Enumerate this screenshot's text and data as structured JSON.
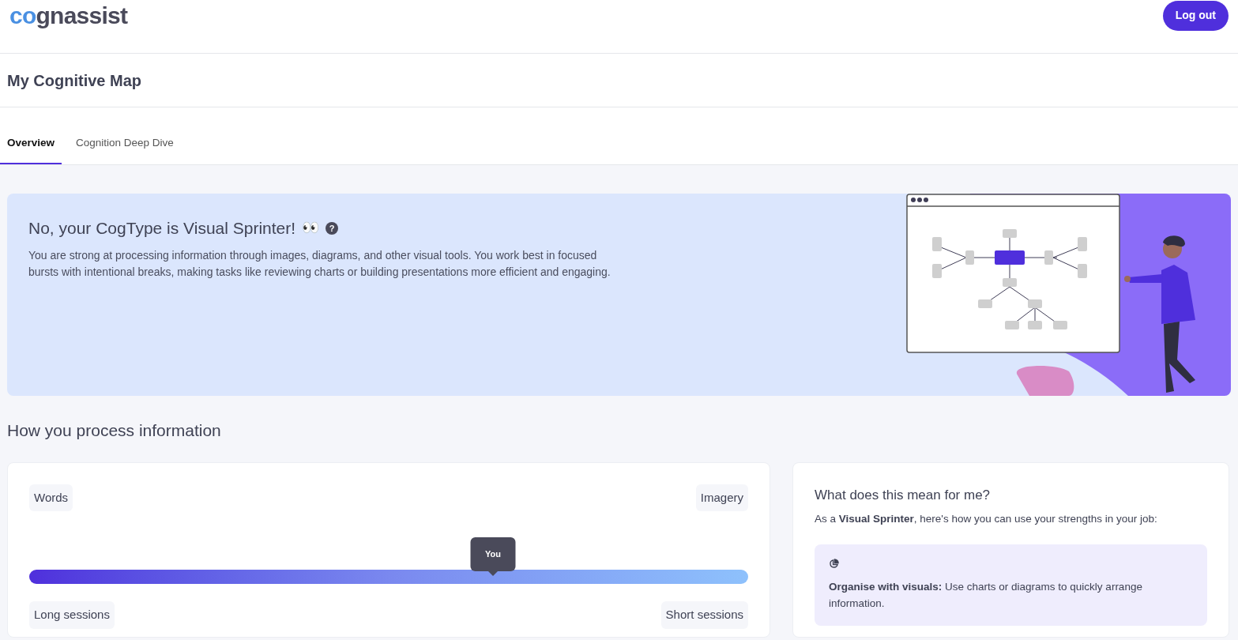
{
  "header": {
    "logo": {
      "prefix": "co",
      "rest": "gnassist"
    },
    "logout_button": "Log out"
  },
  "page_title": "My Cognitive Map",
  "tabs": [
    {
      "label": "Overview",
      "selected": true
    },
    {
      "label": "Cognition Deep Dive",
      "selected": false
    }
  ],
  "banner": {
    "title": "No, your CogType is Visual Sprinter!",
    "emoji": "👀",
    "help_icon": "?",
    "description": "You are strong at processing information through images, diagrams, and other visual tools. You work best in focused bursts with intentional breaks, making tasks like reviewing charts or building presentations more efficient and engaging."
  },
  "section_title": "How you process information",
  "scale_card": {
    "top_left": "Words",
    "top_right": "Imagery",
    "marker": "You",
    "level": 0.645,
    "bottom_left": "Long sessions",
    "bottom_right": "Short sessions"
  },
  "meaning_card": {
    "title": "What does this mean for me?",
    "intro": "As a **Visual Sprinter**, here's how you can use your strengths in your job:",
    "tips": [
      {
        "text": "**Organise with visuals:** Use charts or diagrams to quickly arrange information."
      }
    ]
  }
}
